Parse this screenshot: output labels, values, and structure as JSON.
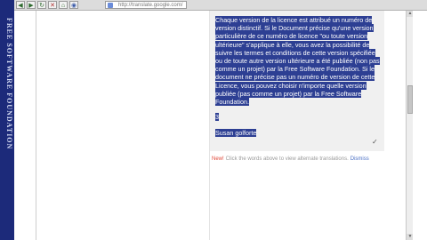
{
  "sidebar": {
    "vertical_text": "FREE SOFTWARE FOUNDATION"
  },
  "toolbar": {
    "address": "http://translate.google.com/"
  },
  "document": {
    "paragraph": "Chaque version de la licence est attribué un numéro de version distinctif. Si le Document précise qu'une version particulière de ce numéro de licence \"ou toute version ultérieure\" s'applique à elle, vous avez la possibilité de suivre les termes et conditions de cette version spécifiée ou de toute autre version ultérieure a été publiée (non pas comme un projet) par la Free Software Foundation. Si le document ne précise pas un numéro de version de cette Licence, vous pouvez choisir n'importe quelle version publiée (pas comme un projet) par la Free Software Foundation.",
    "number": "3",
    "name": "Susan golforte"
  },
  "hint": {
    "new_label": "New!",
    "text": "Click the words above to view alternate translations.",
    "dismiss": "Dismiss"
  },
  "icons": [
    "back-arrow-icon",
    "forward-arrow-icon",
    "reload-icon",
    "stop-icon",
    "home-icon",
    "globe-icon"
  ],
  "colors": {
    "highlight": "#2d3f93",
    "sidebar": "#1c2a7a",
    "bubble": "#f0f0f0"
  }
}
